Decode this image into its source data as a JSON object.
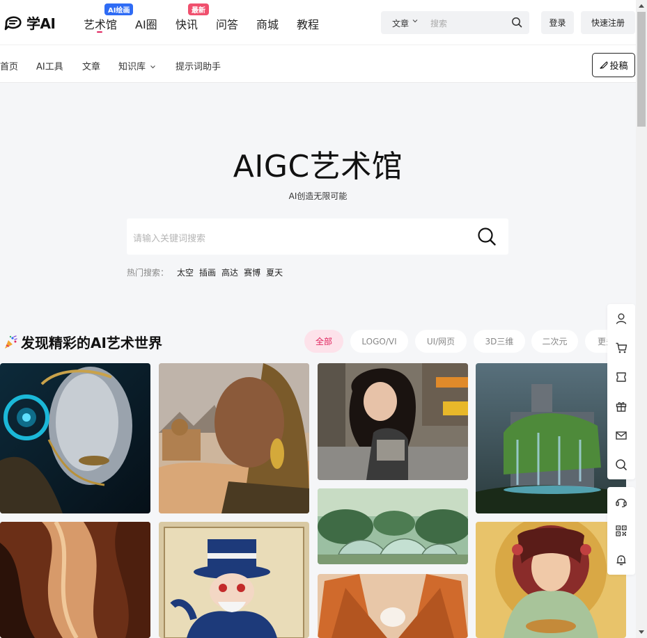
{
  "header": {
    "logo_text": "学AI",
    "nav": [
      {
        "label": "艺术馆",
        "badge": "AI绘画",
        "badge_color": "#2f6cf5",
        "active": true
      },
      {
        "label": "AI圈",
        "badge": "",
        "badge_color": ""
      },
      {
        "label": "快讯",
        "badge": "最新",
        "badge_color": "#f0506e"
      },
      {
        "label": "问答",
        "badge": "",
        "badge_color": ""
      },
      {
        "label": "商城",
        "badge": "",
        "badge_color": ""
      },
      {
        "label": "教程",
        "badge": "",
        "badge_color": ""
      }
    ],
    "search": {
      "category": "文章",
      "placeholder": "搜索"
    },
    "login_label": "登录",
    "register_label": "快速注册"
  },
  "subnav": {
    "items": [
      "首页",
      "AI工具",
      "文章",
      "知识库",
      "提示词助手"
    ],
    "submit_label": "投稿"
  },
  "hero": {
    "title": "AIGC艺术馆",
    "subtitle": "AI创造无限可能",
    "search_placeholder": "请输入关键词搜索",
    "hot_label": "热门搜索：",
    "hot_terms": [
      "太空",
      "插画",
      "高达",
      "赛博",
      "夏天"
    ]
  },
  "section": {
    "title": "发现精彩的AI艺术世界",
    "filters": [
      "全部",
      "LOGO/VI",
      "UI/网页",
      "3D三维",
      "二次元",
      "更多"
    ],
    "active_filter": "全部"
  },
  "colors": {
    "accent": "#e0245e",
    "badge_blue": "#2f6cf5",
    "badge_red": "#f0506e",
    "active_pill_bg": "#fde2ea",
    "page_bg": "#f5f6f8"
  },
  "float_toolbar": {
    "icons": [
      "user-icon",
      "cart-icon",
      "ticket-icon",
      "gift-icon",
      "mail-icon",
      "search-icon"
    ],
    "icons2": [
      "headset-icon",
      "qrcode-icon",
      "bell-icon"
    ]
  }
}
